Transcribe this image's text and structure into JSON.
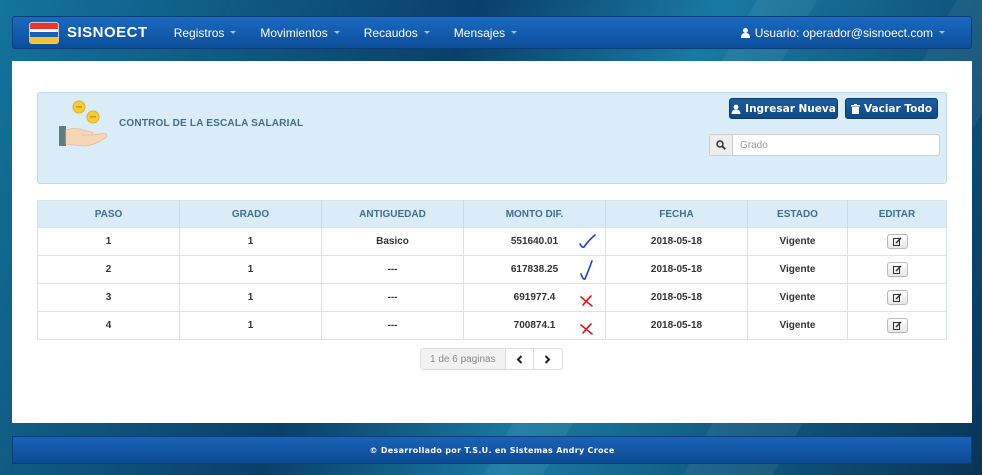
{
  "navbar": {
    "brand": "SISNOECT",
    "menu": [
      {
        "label": "Registros"
      },
      {
        "label": "Movimientos"
      },
      {
        "label": "Recaudos"
      },
      {
        "label": "Mensajes"
      }
    ],
    "user": "Usuario: operador@sisnoect.com"
  },
  "panel": {
    "title": "CONTROL DE LA ESCALA SALARIAL",
    "btn_new": "Ingresar Nueva",
    "btn_clear": "Vaciar Todo",
    "search_placeholder": "Grado"
  },
  "table": {
    "headers": [
      "PASO",
      "GRADO",
      "ANTIGUEDAD",
      "MONTO DIF.",
      "FECHA",
      "ESTADO",
      "EDITAR"
    ],
    "rows": [
      {
        "paso": "1",
        "grado": "1",
        "antiguedad": "Basico",
        "monto": "551640.01",
        "fecha": "2018-05-18",
        "estado": "Vigente",
        "mark": "check"
      },
      {
        "paso": "2",
        "grado": "1",
        "antiguedad": "---",
        "monto": "617838.25",
        "fecha": "2018-05-18",
        "estado": "Vigente",
        "mark": "check"
      },
      {
        "paso": "3",
        "grado": "1",
        "antiguedad": "---",
        "monto": "691977.4",
        "fecha": "2018-05-18",
        "estado": "Vigente",
        "mark": "cross"
      },
      {
        "paso": "4",
        "grado": "1",
        "antiguedad": "---",
        "monto": "700874.1",
        "fecha": "2018-05-18",
        "estado": "Vigente",
        "mark": "cross"
      }
    ]
  },
  "pager": {
    "info": "1 de 6 paginas"
  },
  "footer": {
    "text": "© Desarrollado por T.S.U. en Sistemas Andry Croce"
  },
  "colors": {
    "accent": "#0d4e9a",
    "header_bg": "#d9ecf7",
    "check": "#1a3fd6",
    "cross": "#e0141a"
  }
}
